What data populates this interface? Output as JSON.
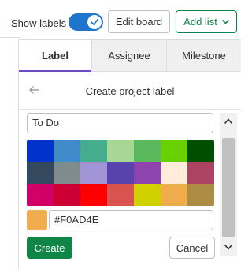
{
  "toolbar": {
    "show_labels": "Show labels",
    "toggle_on": true,
    "edit_board": "Edit board",
    "add_list": "Add list"
  },
  "tabs": [
    {
      "label": "Label",
      "active": true
    },
    {
      "label": "Assignee",
      "active": false
    },
    {
      "label": "Milestone",
      "active": false
    }
  ],
  "dropdown": {
    "title": "Create project label",
    "name_value": "To Do",
    "palette": [
      "#0033cc",
      "#428bca",
      "#44ad8e",
      "#a8d695",
      "#5cb85c",
      "#69d100",
      "#004e00",
      "#34495e",
      "#7f8c8d",
      "#a295d6",
      "#5843ad",
      "#8e44ad",
      "#ffecdb",
      "#ad4363",
      "#d10069",
      "#cc0033",
      "#ff0000",
      "#d9534f",
      "#d1d100",
      "#f0ad4e",
      "#ad8d43"
    ],
    "color_value": "#F0AD4E",
    "create_label": "Create",
    "cancel_label": "Cancel"
  },
  "colors": {
    "accent_blue": "#1f75cb",
    "green": "#108548",
    "tab_underline": "#6e49cb"
  }
}
